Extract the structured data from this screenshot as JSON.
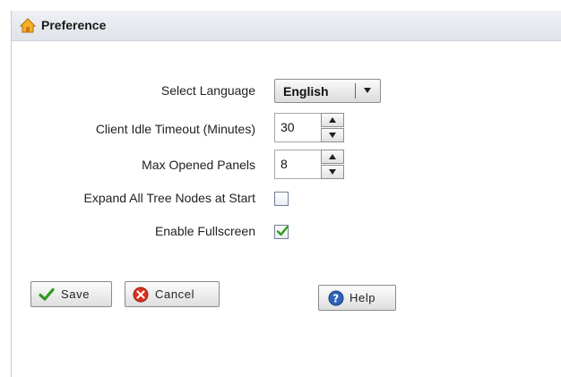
{
  "panel": {
    "title": "Preference",
    "title_icon": "home-icon"
  },
  "form": {
    "language": {
      "label": "Select Language",
      "value": "English"
    },
    "idle_timeout": {
      "label": "Client Idle Timeout (Minutes)",
      "value": "30"
    },
    "max_panels": {
      "label": "Max Opened Panels",
      "value": "8"
    },
    "expand_tree": {
      "label": "Expand All Tree Nodes at Start",
      "checked": false
    },
    "fullscreen": {
      "label": "Enable Fullscreen",
      "checked": true
    }
  },
  "buttons": {
    "save": {
      "label": "Save",
      "icon": "check-icon"
    },
    "cancel": {
      "label": "Cancel",
      "icon": "cancel-icon"
    },
    "help": {
      "label": "Help",
      "icon": "help-icon"
    }
  },
  "colors": {
    "check_green": "#2f9a1f",
    "cancel_red": "#d8321e",
    "help_blue": "#2e63b8",
    "home_orange": "#f0a020"
  }
}
